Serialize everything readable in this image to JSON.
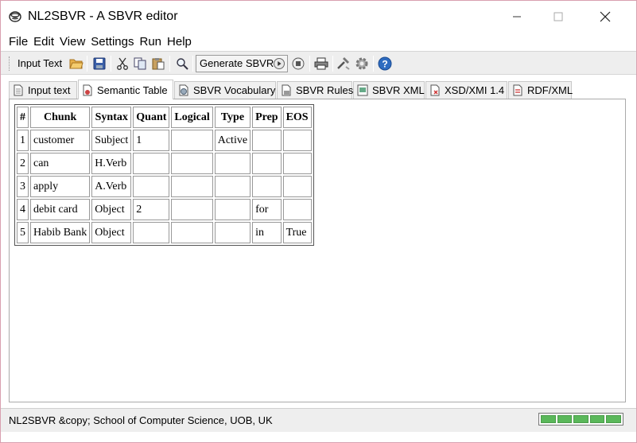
{
  "window": {
    "title": "NL2SBVR - A SBVR editor"
  },
  "menu": [
    "File",
    "Edit",
    "View",
    "Settings",
    "Run",
    "Help"
  ],
  "toolbar": {
    "input_text_label": "Input Text",
    "generate_label": "Generate SBVR",
    "icons": [
      "open-folder-icon",
      "save-icon",
      "cut-icon",
      "copy-icon",
      "paste-icon",
      "find-icon",
      "play-icon",
      "stop-icon",
      "print-icon",
      "tools-icon",
      "settings-icon",
      "help-icon"
    ]
  },
  "tabs": [
    {
      "label": "Input text",
      "active": false
    },
    {
      "label": "Semantic Table",
      "active": true
    },
    {
      "label": "SBVR Vocabulary",
      "active": false
    },
    {
      "label": "SBVR Rules",
      "active": false
    },
    {
      "label": "SBVR XML",
      "active": false
    },
    {
      "label": "XSD/XMI 1.4",
      "active": false
    },
    {
      "label": "RDF/XML",
      "active": false
    }
  ],
  "table": {
    "headers": [
      "#",
      "Chunk",
      "Syntax",
      "Quant",
      "Logical",
      "Type",
      "Prep",
      "EOS"
    ],
    "rows": [
      [
        "1",
        "customer",
        "Subject",
        "1",
        "",
        "Active",
        "",
        ""
      ],
      [
        "2",
        "can",
        "H.Verb",
        "",
        "",
        "",
        "",
        ""
      ],
      [
        "3",
        "apply",
        "A.Verb",
        "",
        "",
        "",
        "",
        ""
      ],
      [
        "4",
        "debit card",
        "Object",
        "2",
        "",
        "",
        "for",
        ""
      ],
      [
        "5",
        "Habib Bank",
        "Object",
        "",
        "",
        "",
        "in",
        "True"
      ]
    ]
  },
  "status": {
    "text": "NL2SBVR &copy; School of Computer Science, UOB, UK",
    "progress": 1.0,
    "progress_color": "#5ab85a"
  }
}
